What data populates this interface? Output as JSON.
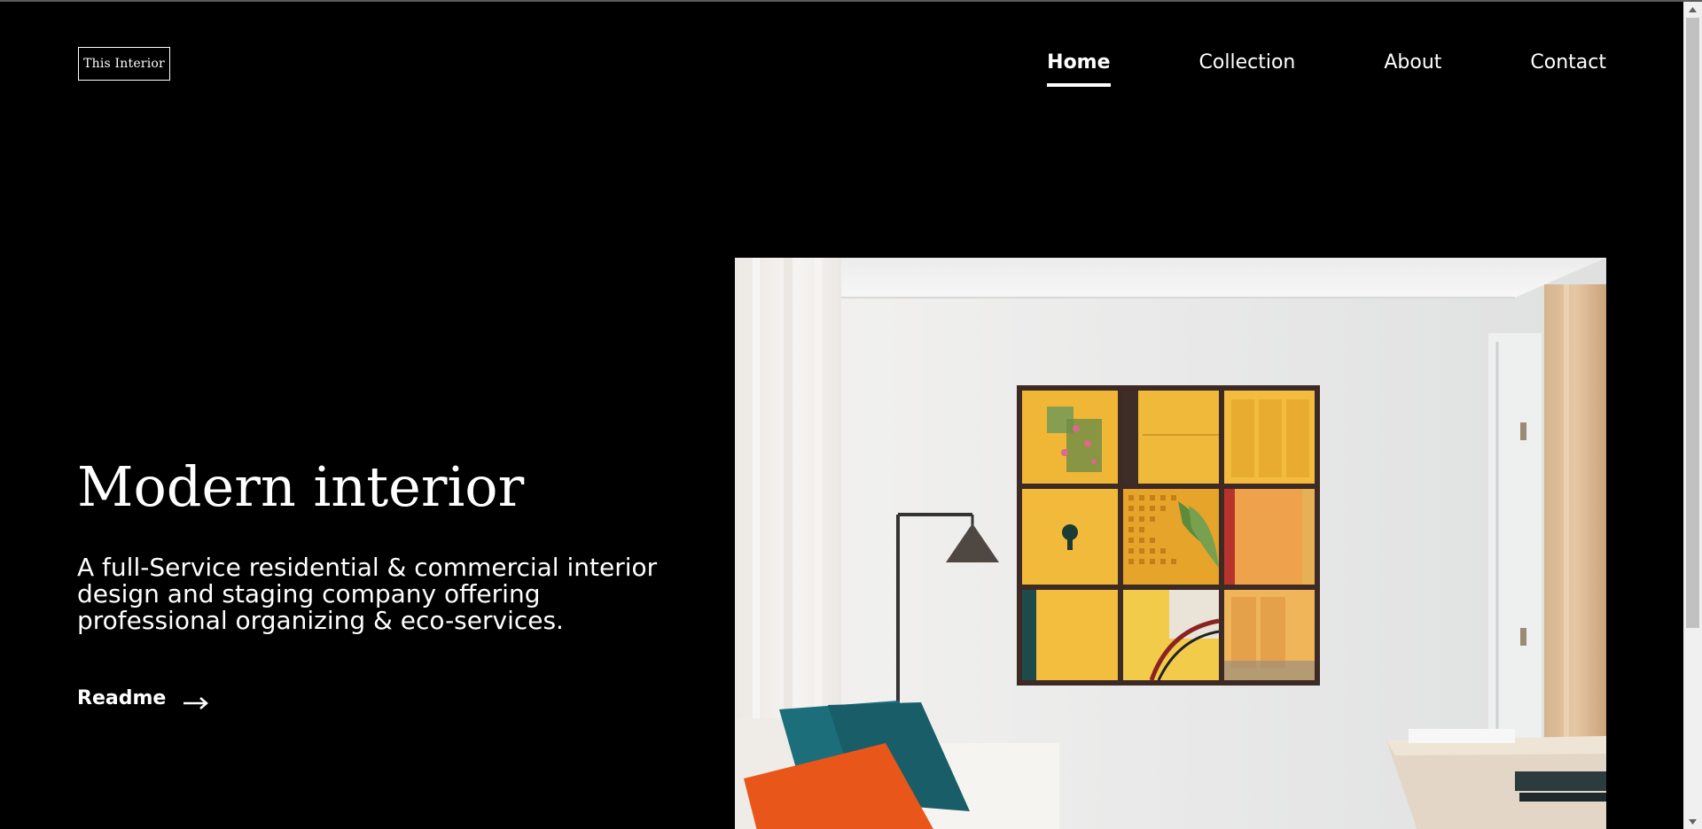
{
  "brand": {
    "logo_text": "This Interior"
  },
  "nav": {
    "items": [
      {
        "label": "Home",
        "active": true
      },
      {
        "label": "Collection",
        "active": false
      },
      {
        "label": "About",
        "active": false
      },
      {
        "label": "Contact",
        "active": false
      }
    ]
  },
  "hero": {
    "title": "Modern interior",
    "description": "A full-Service residential & commercial interior design and staging company offering professional organizing & eco-services.",
    "cta_label": "Readme",
    "cta_icon": "arrow-right-icon"
  },
  "colors": {
    "background": "#000000",
    "text": "#ffffff",
    "accent_yellow": "#f2b735",
    "pillow_orange": "#e8561a",
    "pillow_teal": "#1c6e7a"
  }
}
